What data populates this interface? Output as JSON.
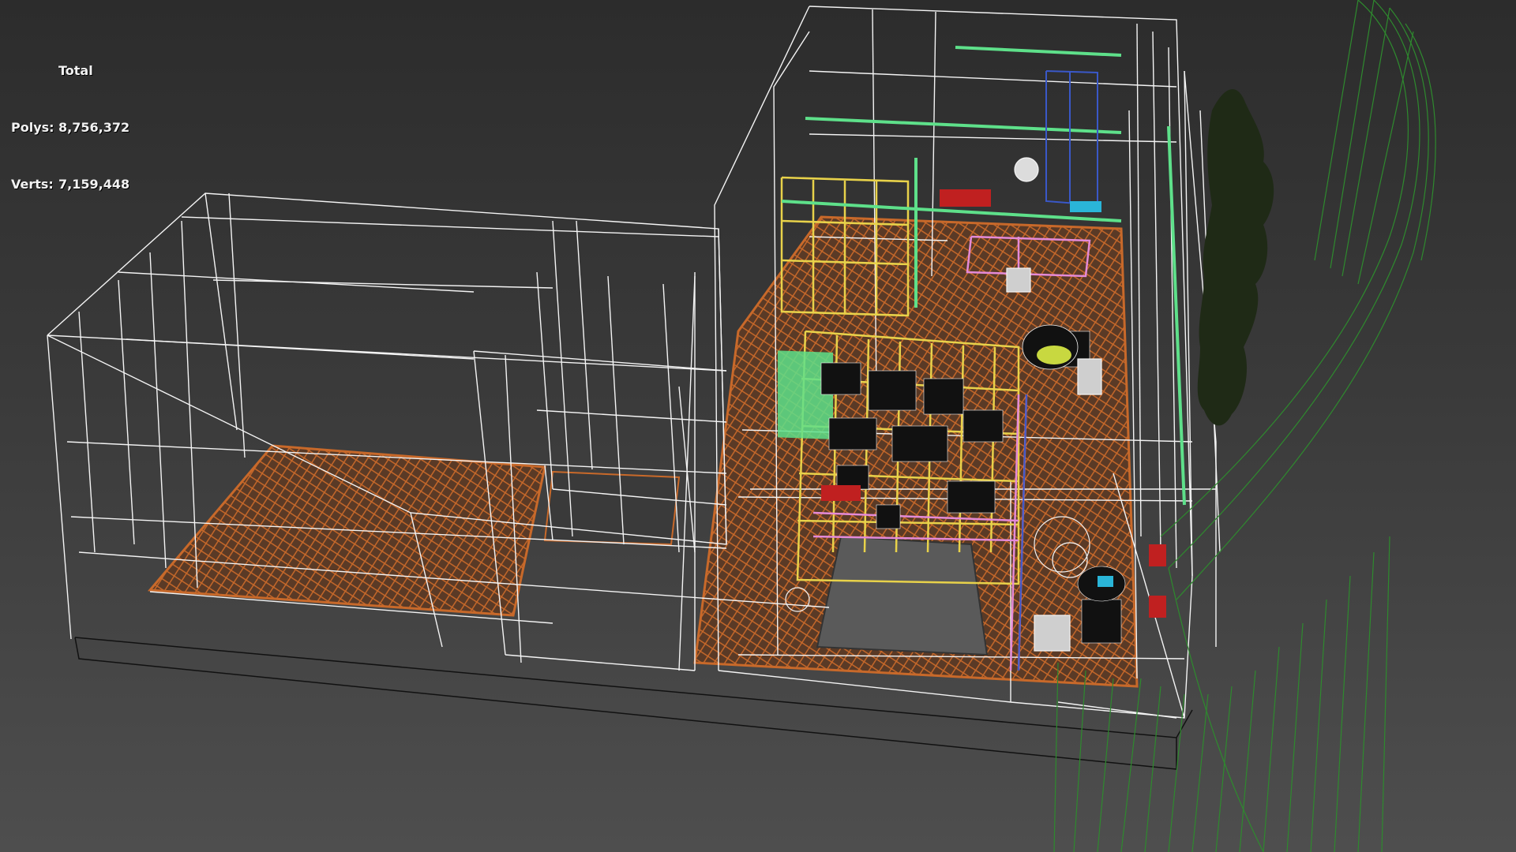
{
  "stats": {
    "title": "Total",
    "polys_label": "Polys:",
    "polys_value": "8,756,372",
    "verts_label": "Verts:",
    "verts_value": "7,159,448"
  },
  "colors": {
    "wire_white": "#f4f4f4",
    "wire_black": "#111111",
    "floor_orange": "#c8692a",
    "floor_fill": "#5a3a26",
    "shelf_yellow": "#e8d24a",
    "rail_green": "#5ee08a",
    "pink": "#e48ad8",
    "tree_green": "#1f2a16",
    "curve_green": "#2e8a2e",
    "rug_grey": "#5a5a5a"
  }
}
